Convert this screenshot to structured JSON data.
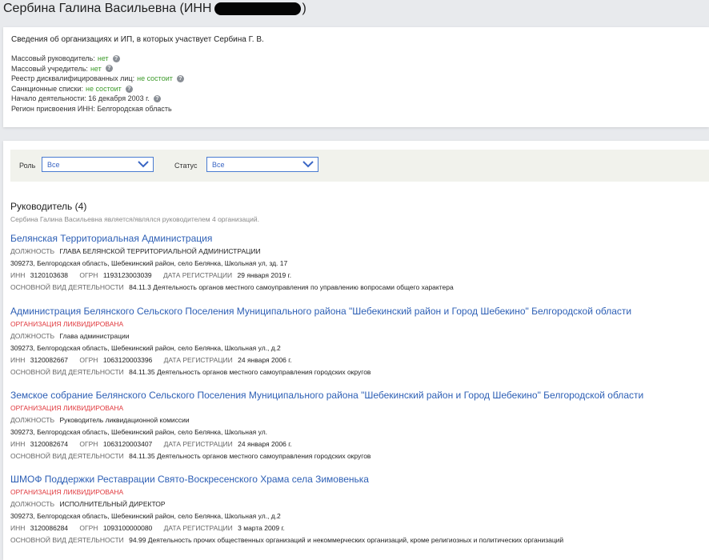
{
  "header": {
    "title_prefix": "Сербина Галина Васильевна (ИНН ",
    "title_suffix": ")"
  },
  "info": {
    "heading": "Сведения об организациях и ИП, в которых участвует Сербина Г. В.",
    "lines": [
      {
        "label": "Массовый руководитель:",
        "value": "нет",
        "help": true
      },
      {
        "label": "Массовый учредитель:",
        "value": "нет",
        "help": true
      },
      {
        "label": "Реестр дисквалифицированных лиц:",
        "value": "не состоит",
        "help": true
      },
      {
        "label": "Санкционные списки:",
        "value": "не состоит",
        "help": true
      },
      {
        "label": "Начало деятельности: 16 декабря 2003 г.",
        "value": "",
        "help": true
      },
      {
        "label": "Регион присвоения ИНН: Белгородская область",
        "value": "",
        "help": false
      }
    ]
  },
  "filters": {
    "role_label": "Роль",
    "role_value": "Все",
    "status_label": "Статус",
    "status_value": "Все"
  },
  "section": {
    "title": "Руководитель (4)",
    "subtitle": "Сербина Галина Васильевна является/являлся руководителем 4 организаций."
  },
  "labels": {
    "position": "ДОЛЖНОСТЬ",
    "inn": "ИНН",
    "ogrn": "ОГРН",
    "reg_date": "ДАТА РЕГИСТРАЦИИ",
    "activity": "ОСНОВНОЙ ВИД ДЕЯТЕЛЬНОСТИ"
  },
  "organizations": [
    {
      "name": "Белянская Территориальная Администрация",
      "status": "",
      "position": "ГЛАВА БЕЛЯНСКОЙ ТЕРРИТОРИАЛЬНОЙ АДМИНИСТРАЦИИ",
      "address": "309273, Белгородская область, Шебекинский район, село Белянка, Школьная ул, зд. 17",
      "inn": "3120103638",
      "ogrn": "1193123003039",
      "reg_date": "29 января 2019 г.",
      "activity": "84.11.3 Деятельность органов местного самоуправления по управлению вопросами общего характера"
    },
    {
      "name": "Администрация Белянского Сельского Поселения Муниципального района \"Шебекинский район и Город Шебекино\" Белгородской области",
      "status": "ОРГАНИЗАЦИЯ ЛИКВИДИРОВАНА",
      "position": "Глава администрации",
      "address": "309273, Белгородская область, Шебекинский район, село Белянка, Школьная ул., д.2",
      "inn": "3120082667",
      "ogrn": "1063120003396",
      "reg_date": "24 января 2006 г.",
      "activity": "84.11.35 Деятельность органов местного самоуправления городских округов"
    },
    {
      "name": "Земское собрание Белянского Сельского Поселения Муниципального района \"Шебекинский район и Город Шебекино\" Белгородской области",
      "status": "ОРГАНИЗАЦИЯ ЛИКВИДИРОВАНА",
      "position": "Руководитель ликвидационной комиссии",
      "address": "309273, Белгородская область, Шебекинский район, село Белянка, Школьная ул.",
      "inn": "3120082674",
      "ogrn": "1063120003407",
      "reg_date": "24 января 2006 г.",
      "activity": "84.11.35 Деятельность органов местного самоуправления городских округов"
    },
    {
      "name": "ШМОФ Поддержки Реставрации Свято-Воскресенского Храма села Зимовенька",
      "status": "ОРГАНИЗАЦИЯ ЛИКВИДИРОВАНА",
      "position": "ИСПОЛНИТЕЛЬНЫЙ ДИРЕКТОР",
      "address": "309273, Белгородская область, Шебекинский район, село Белянка, Школьная ул., д.2",
      "inn": "3120086284",
      "ogrn": "1093100000080",
      "reg_date": "3 марта 2009 г.",
      "activity": "94.99 Деятельность прочих общественных организаций и некоммерческих организаций, кроме религиозных и политических организаций"
    }
  ],
  "colors": {
    "link": "#2d5fb5",
    "liquidated": "#e0393e",
    "positive": "#3c9a2a"
  }
}
